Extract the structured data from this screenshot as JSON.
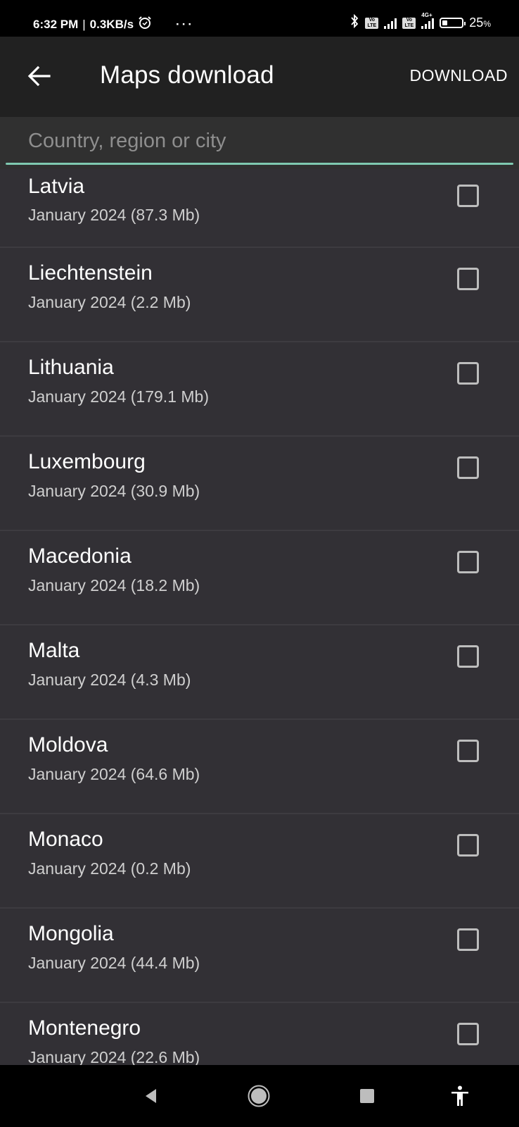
{
  "status_bar": {
    "time": "6:32 PM",
    "network_speed": "0.3KB/s",
    "alarm_icon": "alarm-clock-icon",
    "more_indicator": "···",
    "bluetooth_icon": "bluetooth-icon",
    "volte_label": "Vo LTE",
    "network_type": "4G+",
    "battery_percent": "25",
    "battery_suffix": "%",
    "battery_level": 0.25
  },
  "app_bar": {
    "back_icon": "arrow-left-icon",
    "title": "Maps download",
    "action_label": "DOWNLOAD"
  },
  "search": {
    "placeholder": "Country, region or city",
    "value": ""
  },
  "regions": [
    {
      "name": "Latvia",
      "info": "January 2024 (87.3 Mb)",
      "checked": false
    },
    {
      "name": "Liechtenstein",
      "info": "January 2024 (2.2 Mb)",
      "checked": false
    },
    {
      "name": "Lithuania",
      "info": "January 2024 (179.1 Mb)",
      "checked": false
    },
    {
      "name": "Luxembourg",
      "info": "January 2024 (30.9 Mb)",
      "checked": false
    },
    {
      "name": "Macedonia",
      "info": "January 2024 (18.2 Mb)",
      "checked": false
    },
    {
      "name": "Malta",
      "info": "January 2024 (4.3 Mb)",
      "checked": false
    },
    {
      "name": "Moldova",
      "info": "January 2024 (64.6 Mb)",
      "checked": false
    },
    {
      "name": "Monaco",
      "info": "January 2024 (0.2 Mb)",
      "checked": false
    },
    {
      "name": "Mongolia",
      "info": "January 2024 (44.4 Mb)",
      "checked": false
    },
    {
      "name": "Montenegro",
      "info": "January 2024 (22.6 Mb)",
      "checked": false
    }
  ],
  "nav_bar": {
    "back_icon": "nav-back-triangle-icon",
    "home_icon": "nav-home-circle-icon",
    "recents_icon": "nav-recents-square-icon",
    "accessibility_icon": "accessibility-person-icon"
  }
}
